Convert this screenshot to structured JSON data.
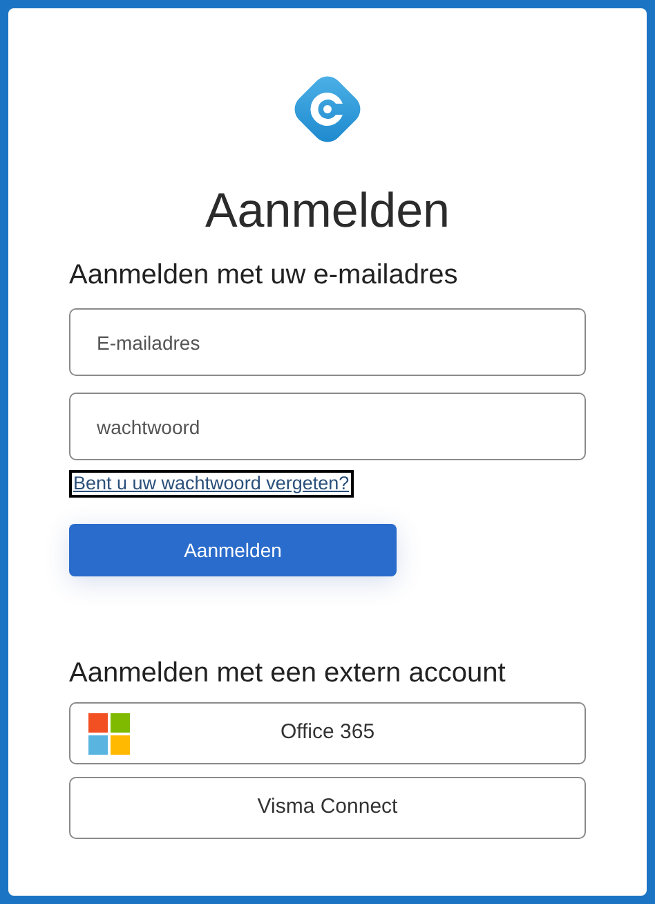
{
  "title": "Aanmelden",
  "email_section": {
    "heading": "Aanmelden met uw e-mailadres",
    "fields": [
      {
        "placeholder": "E-mailadres"
      },
      {
        "placeholder": "wachtwoord"
      }
    ],
    "forgot_link": "Bent u uw wachtwoord vergeten?",
    "submit_button": "Aanmelden"
  },
  "external_section": {
    "heading": "Aanmelden met een extern account",
    "providers": [
      {
        "label": "Office 365",
        "kind": "microsoft"
      },
      {
        "label": "Visma Connect",
        "kind": "plain"
      }
    ]
  }
}
